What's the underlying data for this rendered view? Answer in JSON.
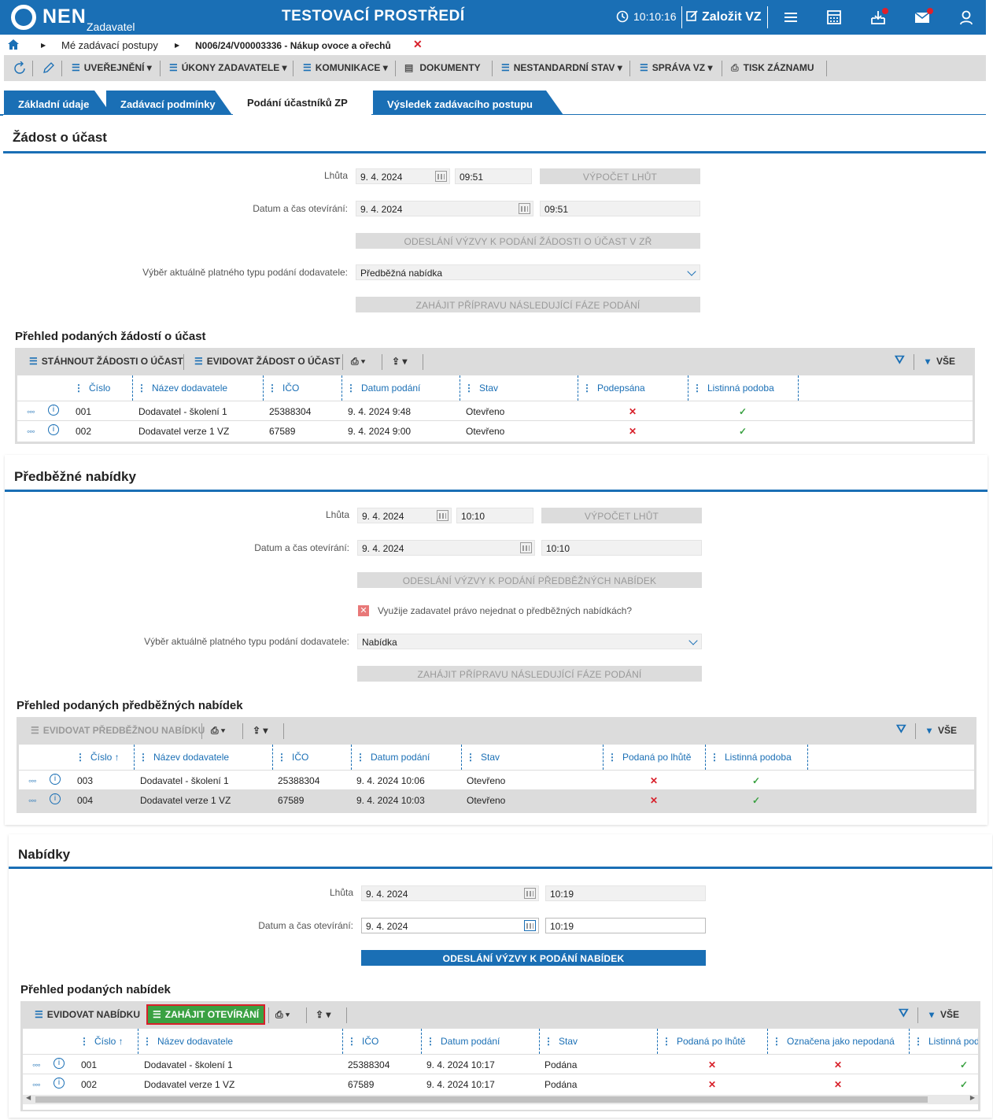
{
  "topbar": {
    "logo": "NEN",
    "logo_sub": "Zadavatel",
    "environment": "TESTOVACÍ PROSTŘEDÍ",
    "time": "10:10:16",
    "create_label": "Založit VZ",
    "icons": [
      "menu-icon",
      "calculator-icon",
      "inbox-icon",
      "mail-icon",
      "user-icon"
    ]
  },
  "breadcrumb": {
    "item1": "Mé zadávací postupy",
    "item2": "N006/24/V00003336 - Nákup ovoce a ořechů"
  },
  "toolbar": {
    "uverejneni": "UVEŘEJNĚNÍ",
    "ukony": "ÚKONY ZADAVATELE",
    "komunikace": "KOMUNIKACE",
    "dokumenty": "DOKUMENTY",
    "nestandardni": "NESTANDARDNÍ STAV",
    "sprava": "SPRÁVA VZ",
    "tisk": "TISK ZÁZNAMU"
  },
  "tabs": {
    "t1": "Základní údaje",
    "t2": "Zadávací podmínky",
    "t3": "Podání účastníků ZP",
    "t4": "Výsledek zadávacího postupu"
  },
  "s1": {
    "title": "Žádost o účast",
    "lhuta_label": "Lhůta",
    "lhuta_date": "9. 4. 2024",
    "lhuta_time": "09:51",
    "vypocet": "VÝPOČET LHŮT",
    "otevirani_label": "Datum a čas otevírání:",
    "otevirani_date": "9. 4. 2024",
    "otevirani_time": "09:51",
    "odeslani": "ODESLÁNÍ VÝZVY K PODÁNÍ ŽÁDOSTI O ÚČAST V ZŘ",
    "vyber_label": "Výběr aktuálně platného typu podání dodavatele:",
    "vyber_value": "Předběžná nabídka",
    "zahajit": "ZAHÁJIT PŘÍPRAVU NÁSLEDUJÍCÍ FÁZE PODÁNÍ",
    "prehled": "Přehled podaných žádostí o účast",
    "tool1": "STÁHNOUT ŽÁDOSTI O ÚČAST",
    "tool2": "EVIDOVAT ŽÁDOST O ÚČAST",
    "vse": "VŠE",
    "cols": [
      "Číslo",
      "Název dodavatele",
      "IČO",
      "Datum podání",
      "Stav",
      "Podepsána",
      "Listinná podoba"
    ],
    "rows": [
      {
        "cislo": "001",
        "nazev": "Dodavatel - školení 1",
        "ico": "25388304",
        "datum": "9. 4. 2024 9:48",
        "stav": "Otevřeno",
        "a": "✕",
        "b": "✓"
      },
      {
        "cislo": "002",
        "nazev": "Dodavatel verze 1 VZ",
        "ico": "67589",
        "datum": "9. 4. 2024 9:00",
        "stav": "Otevřeno",
        "a": "✕",
        "b": "✓"
      }
    ]
  },
  "s2": {
    "title": "Předběžné nabídky",
    "lhuta_label": "Lhůta",
    "lhuta_date": "9. 4. 2024",
    "lhuta_time": "10:10",
    "vypocet": "VÝPOČET LHŮT",
    "otevirani_label": "Datum a čas otevírání:",
    "otevirani_date": "9. 4. 2024",
    "otevirani_time": "10:10",
    "odeslani": "ODESLÁNÍ VÝZVY K PODÁNÍ PŘEDBĚŽNÝCH NABÍDEK",
    "checkbox_label": "Využije zadavatel právo nejednat o předběžných nabídkách?",
    "vyber_label": "Výběr aktuálně platného typu podání dodavatele:",
    "vyber_value": "Nabídka",
    "zahajit": "ZAHÁJIT PŘÍPRAVU NÁSLEDUJÍCÍ FÁZE PODÁNÍ",
    "prehled": "Přehled podaných předběžných nabídek",
    "tool1": "EVIDOVAT PŘEDBĚŽNOU NABÍDKU",
    "vse": "VŠE",
    "cols": [
      "Číslo ↑",
      "Název dodavatele",
      "IČO",
      "Datum podání",
      "Stav",
      "Podaná po lhůtě",
      "Listinná podoba"
    ],
    "rows": [
      {
        "cislo": "003",
        "nazev": "Dodavatel - školení 1",
        "ico": "25388304",
        "datum": "9. 4. 2024 10:06",
        "stav": "Otevřeno",
        "a": "✕",
        "b": "✓"
      },
      {
        "cislo": "004",
        "nazev": "Dodavatel verze 1 VZ",
        "ico": "67589",
        "datum": "9. 4. 2024 10:03",
        "stav": "Otevřeno",
        "a": "✕",
        "b": "✓"
      }
    ]
  },
  "s3": {
    "title": "Nabídky",
    "lhuta_label": "Lhůta",
    "lhuta_date": "9. 4. 2024",
    "lhuta_time": "10:19",
    "otevirani_label": "Datum a čas otevírání:",
    "otevirani_date": "9. 4. 2024",
    "otevirani_time": "10:19",
    "odeslani": "ODESLÁNÍ VÝZVY K PODÁNÍ NABÍDEK",
    "prehled": "Přehled podaných nabídek",
    "tool1": "EVIDOVAT NABÍDKU",
    "tool2": "ZAHÁJIT OTEVÍRÁNÍ",
    "vse": "VŠE",
    "cols": [
      "Číslo ↑",
      "Název dodavatele",
      "IČO",
      "Datum podání",
      "Stav",
      "Podaná po lhůtě",
      "Označena jako nepodaná",
      "Listinná pod"
    ],
    "rows": [
      {
        "cislo": "001",
        "nazev": "Dodavatel - školení 1",
        "ico": "25388304",
        "datum": "9. 4. 2024 10:17",
        "stav": "Podána",
        "a": "✕",
        "b": "✕",
        "c": "✓"
      },
      {
        "cislo": "002",
        "nazev": "Dodavatel verze 1 VZ",
        "ico": "67589",
        "datum": "9. 4. 2024 10:17",
        "stav": "Podána",
        "a": "✕",
        "b": "✕",
        "c": "✓"
      }
    ]
  },
  "colors": {
    "brand": "#1a6fb5",
    "green": "#3aa142",
    "red": "#d8202a",
    "toolbar": "#dcdcdc"
  }
}
